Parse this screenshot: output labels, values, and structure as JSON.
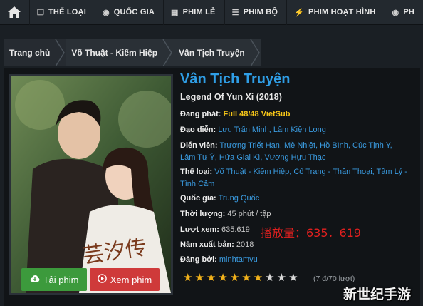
{
  "nav": {
    "items": [
      {
        "icon": "copy-icon",
        "glyph": "❐",
        "label": "THỂ LOẠI"
      },
      {
        "icon": "globe-icon",
        "glyph": "◉",
        "label": "QUỐC GIA"
      },
      {
        "icon": "film-icon",
        "glyph": "▦",
        "label": "PHIM LẺ"
      },
      {
        "icon": "list-icon",
        "glyph": "☰",
        "label": "PHIM BỘ"
      },
      {
        "icon": "bolt-icon",
        "glyph": "⚡",
        "label": "PHIM HOẠT HÌNH"
      },
      {
        "icon": "eye-icon",
        "glyph": "◉",
        "label": "PH"
      }
    ]
  },
  "breadcrumb": [
    "Trang chủ",
    "Võ Thuật - Kiếm Hiệp",
    "Vân Tịch Truyện"
  ],
  "movie": {
    "title": "Vân Tịch Truyện",
    "subtitle": "Legend Of Yun Xi (2018)",
    "status_label": "Đang phát:",
    "status_value": "Full 48/48 VietSub",
    "director_label": "Đạo diễn:",
    "director_value": "Lưu Trấn Minh, Lâm Kiện Long",
    "cast_label": "Diễn viên:",
    "cast_line1": "Trương Triết Hạn, Mễ Nhiệt, Hồ Bình, Cúc Tịnh Y,",
    "cast_line2": "Lâm Tư Ý, Hứa Giai Kì, Vương Hựu Thạc",
    "genre_label": "Thể loại:",
    "genre_line1": "Võ Thuật - Kiếm Hiệp, Cổ Trang - Thần Thoại, Tâm Lý -",
    "genre_line2": "Tình Cảm",
    "country_label": "Quốc gia:",
    "country_value": "Trung Quốc",
    "duration_label": "Thời lượng:",
    "duration_value": "45 phút / tập",
    "views_label": "Lượt xem:",
    "views_value": "635.619",
    "year_label": "Năm xuất bản:",
    "year_value": "2018",
    "poster_label": "Đăng bởi:",
    "poster_value": "minhtamvu",
    "watermark_text": "播放量：635．619",
    "rating": 7,
    "rating_max": 10,
    "votes_text": "(7 đ/70 lượt)"
  },
  "buttons": {
    "download": "Tải phim",
    "watch": "Xem phim"
  },
  "poster_text": "芸汐传",
  "brand_text": "新世纪手游",
  "colors": {
    "accent": "#2f9ee6",
    "download": "#3c9a3c",
    "watch": "#cf3a3a",
    "star": "#f2b21b"
  }
}
